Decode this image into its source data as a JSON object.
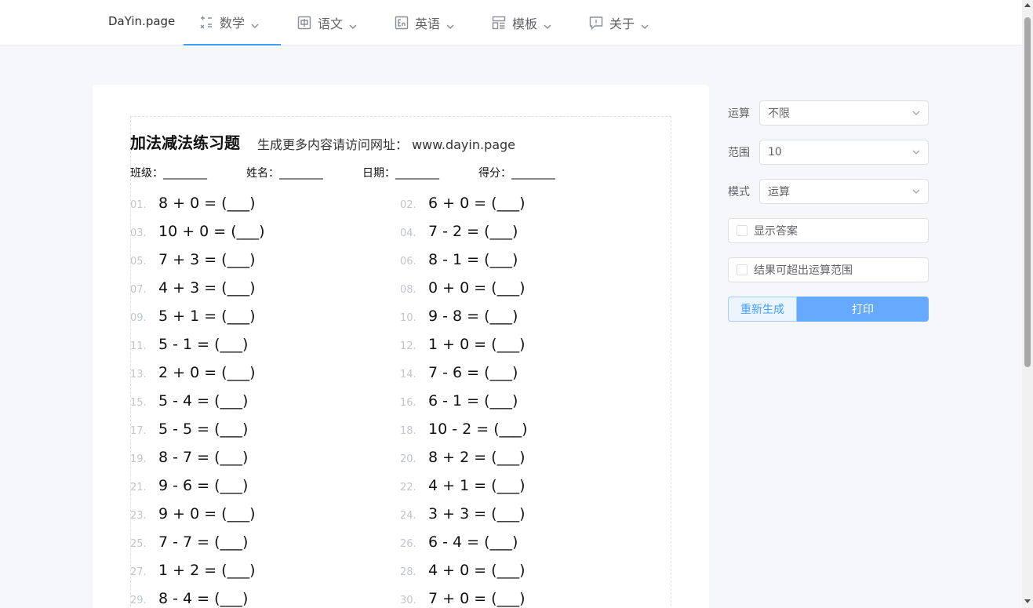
{
  "nav": {
    "brand": "DaYin.page",
    "items": [
      {
        "label": "数学",
        "icon": "math-icon"
      },
      {
        "label": "语文",
        "icon": "chinese-char-icon"
      },
      {
        "label": "英语",
        "icon": "english-icon"
      },
      {
        "label": "模板",
        "icon": "template-icon"
      },
      {
        "label": "关于",
        "icon": "about-icon"
      }
    ]
  },
  "sheet": {
    "title": "加法减法练习题",
    "subtitle": "生成更多内容请访问网址： www.dayin.page",
    "fields": [
      "班级：________",
      "姓名：________",
      "日期：________",
      "得分：________"
    ],
    "problems": [
      {
        "num": "01.",
        "expr": "8 + 0 = (___)"
      },
      {
        "num": "02.",
        "expr": "6 + 0 = (___)"
      },
      {
        "num": "03.",
        "expr": "10 + 0 = (___)"
      },
      {
        "num": "04.",
        "expr": "7 - 2 = (___)"
      },
      {
        "num": "05.",
        "expr": "7 + 3 = (___)"
      },
      {
        "num": "06.",
        "expr": "8 - 1 = (___)"
      },
      {
        "num": "07.",
        "expr": "4 + 3 = (___)"
      },
      {
        "num": "08.",
        "expr": "0 + 0 = (___)"
      },
      {
        "num": "09.",
        "expr": "5 + 1 = (___)"
      },
      {
        "num": "10.",
        "expr": "9 - 8 = (___)"
      },
      {
        "num": "11.",
        "expr": "5 - 1 = (___)"
      },
      {
        "num": "12.",
        "expr": "1 + 0 = (___)"
      },
      {
        "num": "13.",
        "expr": "2 + 0 = (___)"
      },
      {
        "num": "14.",
        "expr": "7 - 6 = (___)"
      },
      {
        "num": "15.",
        "expr": "5 - 4 = (___)"
      },
      {
        "num": "16.",
        "expr": "6 - 1 = (___)"
      },
      {
        "num": "17.",
        "expr": "5 - 5 = (___)"
      },
      {
        "num": "18.",
        "expr": "10 - 2 = (___)"
      },
      {
        "num": "19.",
        "expr": "8 - 7 = (___)"
      },
      {
        "num": "20.",
        "expr": "8 + 2 = (___)"
      },
      {
        "num": "21.",
        "expr": "9 - 6 = (___)"
      },
      {
        "num": "22.",
        "expr": "4 + 1 = (___)"
      },
      {
        "num": "23.",
        "expr": "9 + 0 = (___)"
      },
      {
        "num": "24.",
        "expr": "3 + 3 = (___)"
      },
      {
        "num": "25.",
        "expr": "7 - 7 = (___)"
      },
      {
        "num": "26.",
        "expr": "6 - 4 = (___)"
      },
      {
        "num": "27.",
        "expr": "1 + 2 = (___)"
      },
      {
        "num": "28.",
        "expr": "4 + 0 = (___)"
      },
      {
        "num": "29.",
        "expr": "8 - 4 = (___)"
      },
      {
        "num": "30.",
        "expr": "7 + 0 = (___)"
      }
    ]
  },
  "form": {
    "operation": {
      "label": "运算",
      "value": "不限"
    },
    "range": {
      "label": "范围",
      "value": "10"
    },
    "mode": {
      "label": "模式",
      "value": "运算"
    },
    "show_answer": {
      "label": "显示答案",
      "checked": false
    },
    "allow_overflow": {
      "label": "结果可超出运算范围",
      "checked": false
    },
    "regenerate_label": "重新生成",
    "print_label": "打印"
  },
  "colors": {
    "accent": "#409eff",
    "print_button": "#66aaff"
  }
}
